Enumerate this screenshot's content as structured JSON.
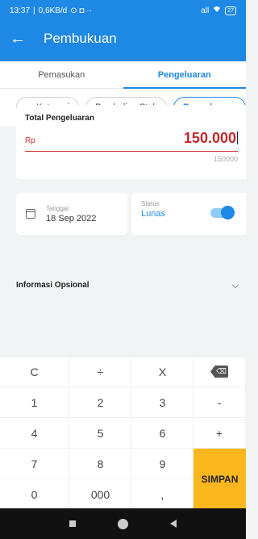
{
  "status_bar": {
    "time": "13:37",
    "speed": "0,6KB/d",
    "extra_icons": "⊙ ◘ ··",
    "signal": "all",
    "wifi": "wifi-icon",
    "battery": "27"
  },
  "toolbar": {
    "back_icon": "←",
    "title": "Pembukuan"
  },
  "tabs": [
    {
      "label": "Pemasukan"
    },
    {
      "label": "Pengeluaran"
    }
  ],
  "chips": [
    {
      "icon": "≡",
      "label": "Kategori"
    },
    {
      "label": "Pembelian Stok"
    },
    {
      "label": "Pengeluaran"
    }
  ],
  "total": {
    "label": "Total Pengeluaran",
    "currency": "Rp",
    "value": "150.000",
    "hint": "150000"
  },
  "date_field": {
    "label": "Tanggal",
    "value": "18 Sep 2022"
  },
  "status_field": {
    "label": "Status",
    "value": "Lunas",
    "toggle_on": true
  },
  "optional": {
    "label": "Informasi Opsional"
  },
  "keypad": {
    "keys": [
      {
        "label": "C",
        "name": "key-clear"
      },
      {
        "label": "÷",
        "name": "key-divide"
      },
      {
        "label": "X",
        "name": "key-multiply"
      },
      {
        "label": "⌫",
        "name": "key-backspace",
        "icon": "backspace-icon"
      },
      {
        "label": "1",
        "name": "key-1"
      },
      {
        "label": "2",
        "name": "key-2"
      },
      {
        "label": "3",
        "name": "key-3"
      },
      {
        "label": "-",
        "name": "key-minus"
      },
      {
        "label": "4",
        "name": "key-4"
      },
      {
        "label": "5",
        "name": "key-5"
      },
      {
        "label": "6",
        "name": "key-6"
      },
      {
        "label": "+",
        "name": "key-plus"
      },
      {
        "label": "7",
        "name": "key-7"
      },
      {
        "label": "8",
        "name": "key-8"
      },
      {
        "label": "9",
        "name": "key-9"
      },
      {
        "label": "0",
        "name": "key-0"
      },
      {
        "label": "000",
        "name": "key-000"
      },
      {
        "label": ",",
        "name": "key-comma"
      }
    ],
    "save_label": "SIMPAN"
  },
  "colors": {
    "primary": "#1e88e5",
    "amount": "#c62828",
    "save": "#fbb81e"
  }
}
